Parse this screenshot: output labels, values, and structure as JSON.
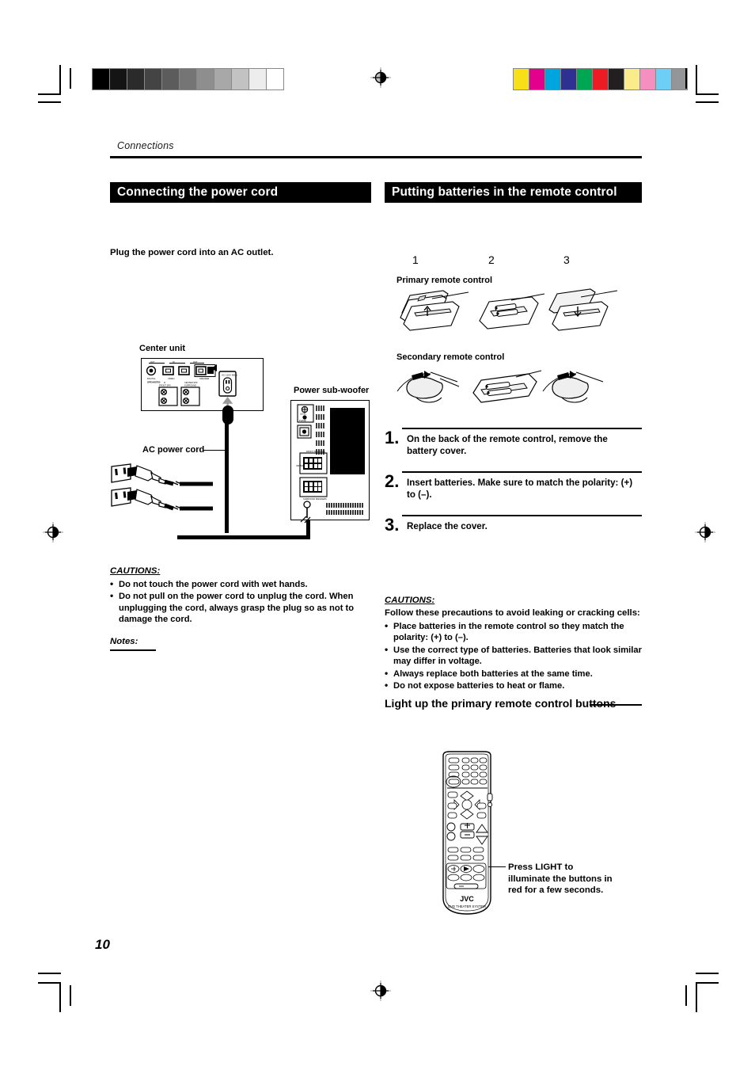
{
  "page": {
    "running_head": "Connections",
    "page_number": "10"
  },
  "left_column": {
    "banner": "Connecting the power cord",
    "intro": "Plug the power cord into an AC outlet.",
    "diagram": {
      "center_unit_label": "Center unit",
      "ac_power_cord_label": "AC power cord",
      "power_subwoofer_label": "Power sub-woofer"
    },
    "cautions_heading": "CAUTIONS:",
    "cautions": [
      "Do not touch the power cord with wet hands.",
      "Do not pull on the power cord to unplug the cord. When unplugging the cord, always grasp the plug so as not to damage the cord."
    ],
    "notes_heading": "Notes:"
  },
  "right_column": {
    "banner": "Putting batteries in the remote control",
    "step_numbers": [
      "1",
      "2",
      "3"
    ],
    "primary_label": "Primary remote control",
    "secondary_label": "Secondary remote control",
    "steps": [
      {
        "num": "1.",
        "text": "On the back of the remote control, remove the battery cover."
      },
      {
        "num": "2.",
        "text": "Insert batteries. Make sure to match the polarity: (+) to (–)."
      },
      {
        "num": "3.",
        "text": "Replace the cover."
      }
    ],
    "cautions_heading": "CAUTIONS:",
    "cautions_intro": "Follow these precautions to avoid leaking or cracking cells:",
    "cautions": [
      "Place batteries in the remote control so they match the polarity: (+) to (–).",
      "Use the correct type of batteries. Batteries that look similar may differ in voltage.",
      "Always replace both batteries at the same time.",
      "Do not expose batteries to heat or flame."
    ],
    "light_heading": "Light up the primary remote control buttons",
    "remote": {
      "brand": "JVC",
      "system_label": "DVD THEATER SYSTEM"
    },
    "callout": "Press LIGHT to illuminate the buttons in red for a few seconds."
  },
  "press_marks": {
    "grey_wedge": [
      "#000000",
      "#141414",
      "#2b2b2b",
      "#444444",
      "#5c5c5c",
      "#757575",
      "#8e8e8e",
      "#a8a8a8",
      "#c2c2c2",
      "#ededed",
      "#ffffff"
    ],
    "color_bar": [
      "#f7e017",
      "#e3008c",
      "#00a5e0",
      "#2e3192",
      "#00a651",
      "#ed1c24",
      "#231f20",
      "#faec8a",
      "#f48fc0",
      "#6dcff6",
      "#939598"
    ]
  }
}
